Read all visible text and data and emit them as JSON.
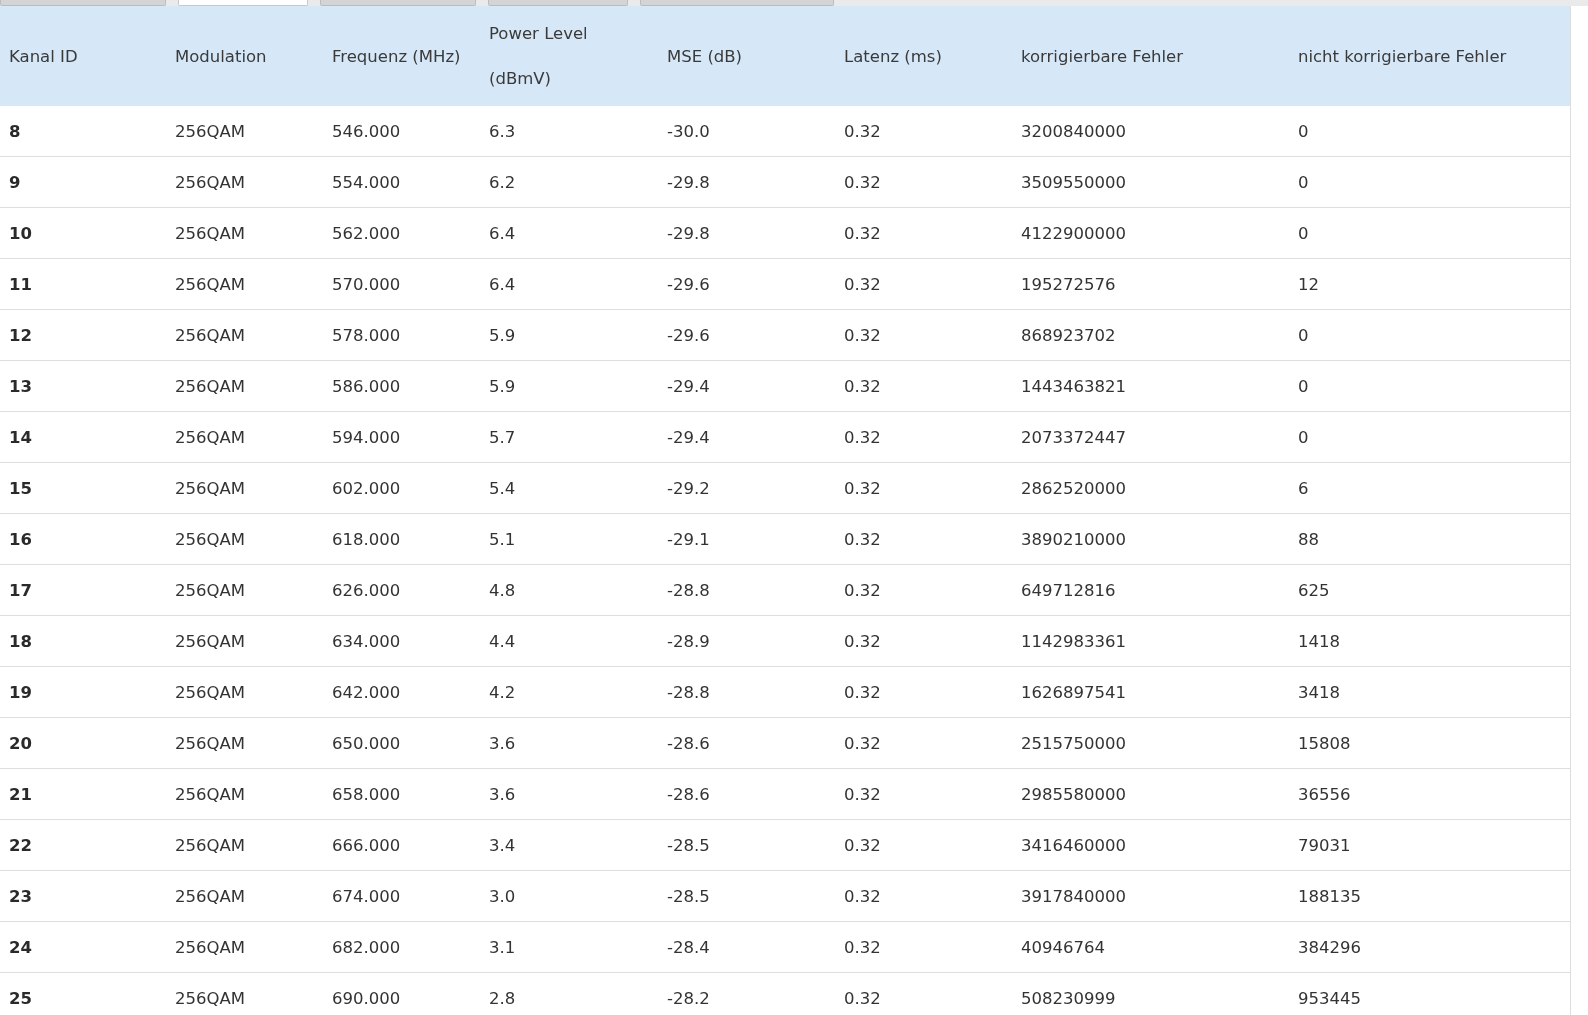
{
  "tabs": [
    {
      "selected": false
    },
    {
      "selected": true
    },
    {
      "selected": false
    },
    {
      "selected": false
    },
    {
      "selected": false
    }
  ],
  "table": {
    "columns": [
      "Kanal ID",
      "Modulation",
      "Frequenz (MHz)",
      "Power Level (dBmV)",
      "MSE (dB)",
      "Latenz (ms)",
      "korrigierbare Fehler",
      "nicht korrigierbare Fehler"
    ],
    "rows": [
      [
        "8",
        "256QAM",
        "546.000",
        "6.3",
        "-30.0",
        "0.32",
        "3200840000",
        "0"
      ],
      [
        "9",
        "256QAM",
        "554.000",
        "6.2",
        "-29.8",
        "0.32",
        "3509550000",
        "0"
      ],
      [
        "10",
        "256QAM",
        "562.000",
        "6.4",
        "-29.8",
        "0.32",
        "4122900000",
        "0"
      ],
      [
        "11",
        "256QAM",
        "570.000",
        "6.4",
        "-29.6",
        "0.32",
        "195272576",
        "12"
      ],
      [
        "12",
        "256QAM",
        "578.000",
        "5.9",
        "-29.6",
        "0.32",
        "868923702",
        "0"
      ],
      [
        "13",
        "256QAM",
        "586.000",
        "5.9",
        "-29.4",
        "0.32",
        "1443463821",
        "0"
      ],
      [
        "14",
        "256QAM",
        "594.000",
        "5.7",
        "-29.4",
        "0.32",
        "2073372447",
        "0"
      ],
      [
        "15",
        "256QAM",
        "602.000",
        "5.4",
        "-29.2",
        "0.32",
        "2862520000",
        "6"
      ],
      [
        "16",
        "256QAM",
        "618.000",
        "5.1",
        "-29.1",
        "0.32",
        "3890210000",
        "88"
      ],
      [
        "17",
        "256QAM",
        "626.000",
        "4.8",
        "-28.8",
        "0.32",
        "649712816",
        "625"
      ],
      [
        "18",
        "256QAM",
        "634.000",
        "4.4",
        "-28.9",
        "0.32",
        "1142983361",
        "1418"
      ],
      [
        "19",
        "256QAM",
        "642.000",
        "4.2",
        "-28.8",
        "0.32",
        "1626897541",
        "3418"
      ],
      [
        "20",
        "256QAM",
        "650.000",
        "3.6",
        "-28.6",
        "0.32",
        "2515750000",
        "15808"
      ],
      [
        "21",
        "256QAM",
        "658.000",
        "3.6",
        "-28.6",
        "0.32",
        "2985580000",
        "36556"
      ],
      [
        "22",
        "256QAM",
        "666.000",
        "3.4",
        "-28.5",
        "0.32",
        "3416460000",
        "79031"
      ],
      [
        "23",
        "256QAM",
        "674.000",
        "3.0",
        "-28.5",
        "0.32",
        "3917840000",
        "188135"
      ],
      [
        "24",
        "256QAM",
        "682.000",
        "3.1",
        "-28.4",
        "0.32",
        "40946764",
        "384296"
      ],
      [
        "25",
        "256QAM",
        "690.000",
        "2.8",
        "-28.2",
        "0.32",
        "508230999",
        "953445"
      ]
    ]
  }
}
